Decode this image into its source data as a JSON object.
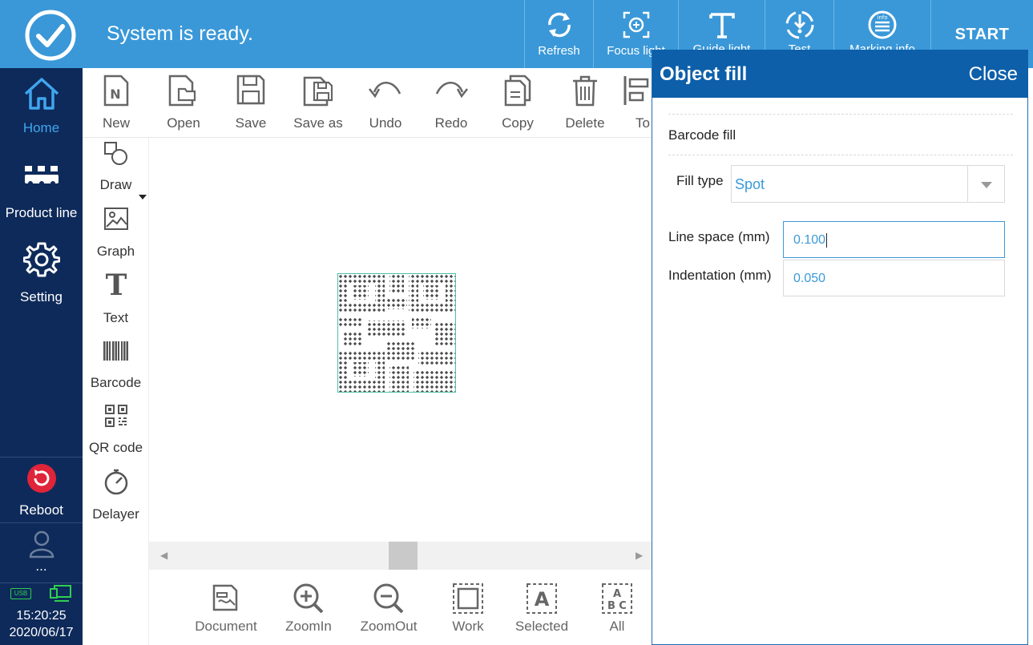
{
  "status": {
    "text": "System is ready."
  },
  "top_buttons": [
    {
      "label": "Refresh",
      "icon": "refresh-icon"
    },
    {
      "label": "Focus light",
      "icon": "focus-light-icon"
    },
    {
      "label": "Guide light",
      "icon": "guide-light-icon"
    },
    {
      "label": "Test",
      "icon": "test-icon"
    },
    {
      "label": "Marking info",
      "icon": "info-icon"
    }
  ],
  "start_label": "START",
  "sidebar": {
    "items": [
      {
        "label": "Home",
        "icon": "home-icon",
        "active": true
      },
      {
        "label": "Product line",
        "icon": "product-line-icon"
      },
      {
        "label": "Setting",
        "icon": "gear-icon"
      }
    ],
    "reboot_label": "Reboot",
    "user_label": "...",
    "time": "15:20:25",
    "date": "2020/06/17",
    "usb_label": "USB"
  },
  "toolbar": [
    {
      "label": "New",
      "icon": "new-file-icon"
    },
    {
      "label": "Open",
      "icon": "open-folder-icon"
    },
    {
      "label": "Save",
      "icon": "save-icon"
    },
    {
      "label": "Save as",
      "icon": "save-as-icon"
    },
    {
      "label": "Undo",
      "icon": "undo-icon"
    },
    {
      "label": "Redo",
      "icon": "redo-icon"
    },
    {
      "label": "Copy",
      "icon": "copy-icon"
    },
    {
      "label": "Delete",
      "icon": "trash-icon"
    },
    {
      "label": "To",
      "icon": "align-icon"
    }
  ],
  "tools": [
    {
      "label": "Draw",
      "icon": "draw-shapes-icon"
    },
    {
      "label": "Graph",
      "icon": "image-icon"
    },
    {
      "label": "Text",
      "icon": "text-icon"
    },
    {
      "label": "Barcode",
      "icon": "barcode-icon"
    },
    {
      "label": "QR code",
      "icon": "qr-code-icon"
    },
    {
      "label": "Delayer",
      "icon": "stopwatch-icon"
    }
  ],
  "bottom_buttons": [
    {
      "label": "Document",
      "icon": "document-icon"
    },
    {
      "label": "ZoomIn",
      "icon": "zoom-in-icon"
    },
    {
      "label": "ZoomOut",
      "icon": "zoom-out-icon"
    },
    {
      "label": "Work",
      "icon": "work-area-icon"
    },
    {
      "label": "Selected",
      "icon": "selected-icon"
    },
    {
      "label": "All",
      "icon": "all-icon"
    }
  ],
  "dialog": {
    "title": "Object fill",
    "close_label": "Close",
    "section": "Barcode fill",
    "fill_type_label": "Fill type",
    "fill_type_value": "Spot",
    "line_space_label": "Line space (mm)",
    "line_space_value": "0.100",
    "indentation_label": "Indentation (mm)",
    "indentation_value": "0.050"
  },
  "colors": {
    "topbar": "#3a98d8",
    "sidebar": "#0e2a5a",
    "dialog_header": "#0d5fa9",
    "accent_text": "#3a9ad9",
    "reboot": "#e0243a",
    "status_green": "#2fcf4f"
  }
}
